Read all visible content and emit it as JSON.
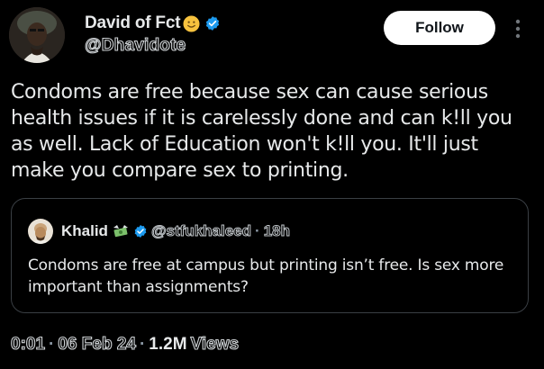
{
  "author": {
    "name": "David of Fct",
    "handle": "@Dhavidote",
    "emoji_icon": "slightly-smiling-face-icon",
    "verified_icon": "verified-badge-icon"
  },
  "actions": {
    "follow_label": "Follow",
    "more_icon": "more-vertical-icon"
  },
  "tweet": {
    "text": "Condoms are free because sex can cause serious health issues if it is carelessly done and can k!ll you as well. Lack of Education won't k!ll you. It'll just make you compare sex to printing."
  },
  "quoted_tweet": {
    "name": "Khalid",
    "money_icon": "money-with-wings-icon",
    "verified_icon": "verified-badge-icon",
    "handle": "@stfukhaleed",
    "separator": "·",
    "time": "18h",
    "text": "Condoms are free at campus but printing isn’t free. Is sex more important than assignments?"
  },
  "meta": {
    "time": "0:01",
    "separator": "·",
    "date": "06 Feb 24",
    "views_count": "1.2M",
    "views_label": "Views"
  },
  "colors": {
    "background": "#000000",
    "text": "#e7e9ea",
    "muted": "#8b98a5",
    "verified": "#1d9bf0",
    "border": "#3a3f44"
  }
}
